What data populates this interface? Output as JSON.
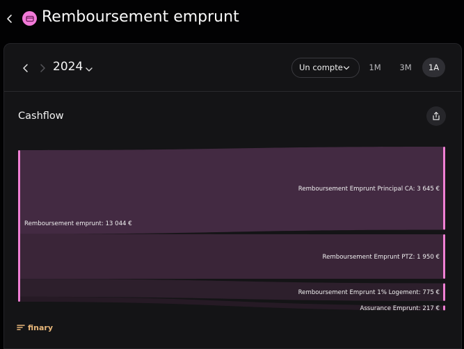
{
  "header": {
    "title": "Remboursement emprunt",
    "accent": "#f27ad8"
  },
  "toolbar": {
    "year": "2024",
    "account_select": "Un compte",
    "ranges": [
      "1M",
      "3M",
      "1A"
    ],
    "active_range": "1A"
  },
  "card": {
    "title": "Cashflow"
  },
  "chart_data": {
    "type": "sankey",
    "source": {
      "name": "Remboursement emprunt",
      "label": "Remboursement emprunt: 13 044 €",
      "value": 13044
    },
    "targets": [
      {
        "name": "Remboursement Emprunt Principal CA",
        "label": "Remboursement Emprunt Principal CA: 3 645 €",
        "value": 3645
      },
      {
        "name": "Remboursement Emprunt PTZ",
        "label": "Remboursement Emprunt PTZ: 1 950 €",
        "value": 1950
      },
      {
        "name": "Remboursement Emprunt 1% Logement",
        "label": "Remboursement Emprunt 1% Logement: 775 €",
        "value": 775
      },
      {
        "name": "Assurance Emprunt",
        "label": "Assurance Emprunt: 217 €",
        "value": 217
      }
    ],
    "node_color": "#f080d4",
    "link_colors": [
      "#432a42",
      "#3a2538",
      "#2d1f2c",
      "#261a25"
    ]
  },
  "brand": {
    "logo_text": "finary"
  }
}
